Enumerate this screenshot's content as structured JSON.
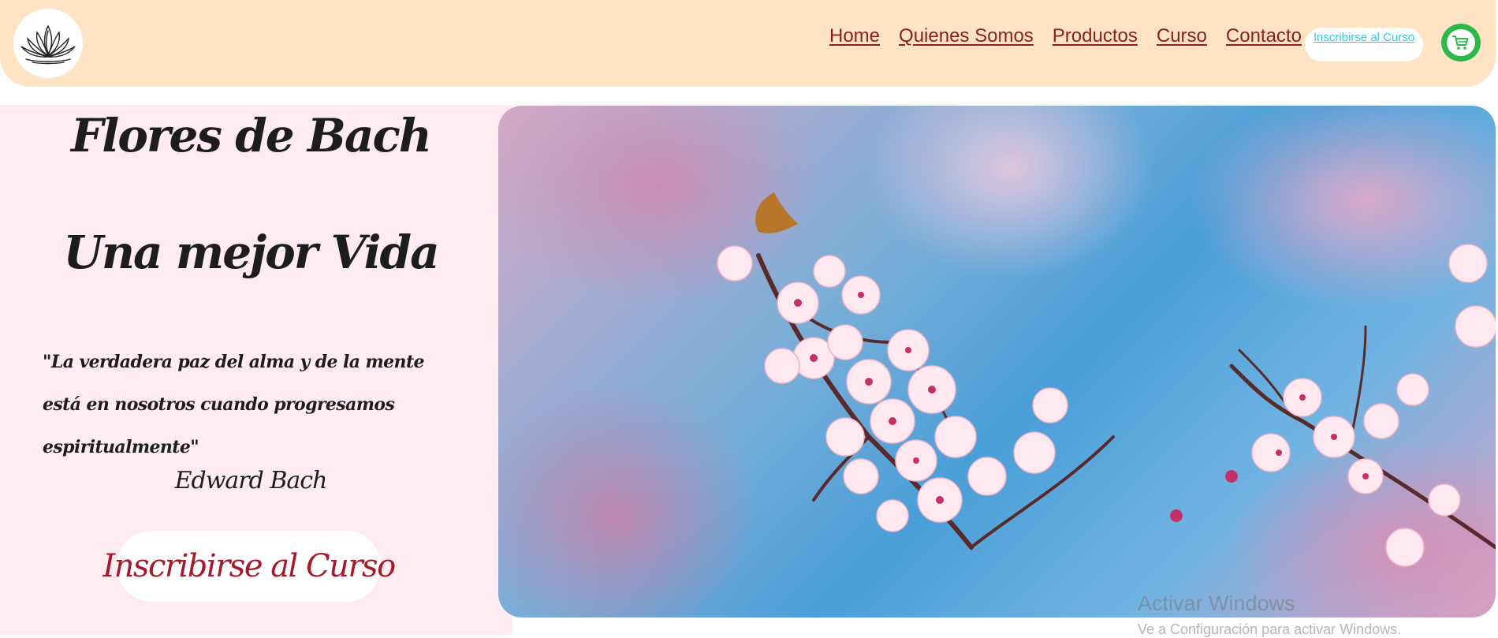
{
  "header": {
    "logo_icon": "lotus-icon",
    "background_color": "#ffe3c5"
  },
  "nav": {
    "items": [
      "Home",
      "Quienes Somos",
      "Productos",
      "Curso",
      "Contacto"
    ],
    "cta_label": "Inscribirse al Curso",
    "cart_icon": "shopping-cart-icon"
  },
  "hero": {
    "title_line1": "Flores de Bach",
    "title_line2": "Una mejor Vida",
    "quote": "\"La verdadera paz del alma y de la mente está en nosotros cuando progresamos espiritualmente\"",
    "author": "Edward Bach",
    "cta_label": "Inscribirse al Curso",
    "image_subject": "cherry-blossom-branch"
  },
  "windows_watermark": {
    "line1": "Activar Windows",
    "line2": "Ve a Configuración para activar Windows."
  },
  "colors": {
    "accent": "#8b1e1e",
    "pink_panel": "#ffecf1",
    "cart_green": "#2db84a",
    "link_cyan": "#22d3ee",
    "cta_red": "#a5192a"
  }
}
